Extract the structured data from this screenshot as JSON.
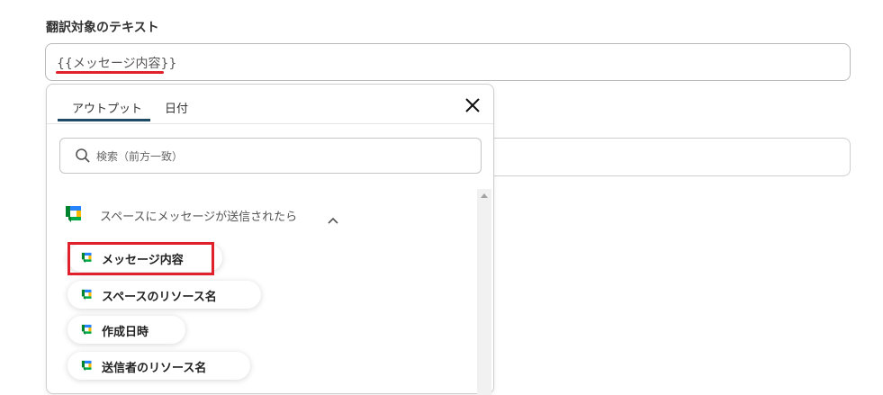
{
  "form": {
    "field_label": "翻訳対象のテキスト",
    "field_value": "{{メッセージ内容}}"
  },
  "popup": {
    "tabs": [
      {
        "label": "アウトプット",
        "active": true
      },
      {
        "label": "日付",
        "active": false
      }
    ],
    "search_placeholder": "検索（前方一致）",
    "group": {
      "label": "スペースにメッセージが送信されたら",
      "icon": "google-chat-icon",
      "expanded": true
    },
    "items": [
      {
        "label": "メッセージ内容",
        "highlighted": true
      },
      {
        "label": "スペースのリソース名",
        "highlighted": false
      },
      {
        "label": "作成日時",
        "highlighted": false
      },
      {
        "label": "送信者のリソース名",
        "highlighted": false
      }
    ]
  },
  "colors": {
    "highlight": "#e0202a",
    "tab_active": "#1f4a66"
  }
}
